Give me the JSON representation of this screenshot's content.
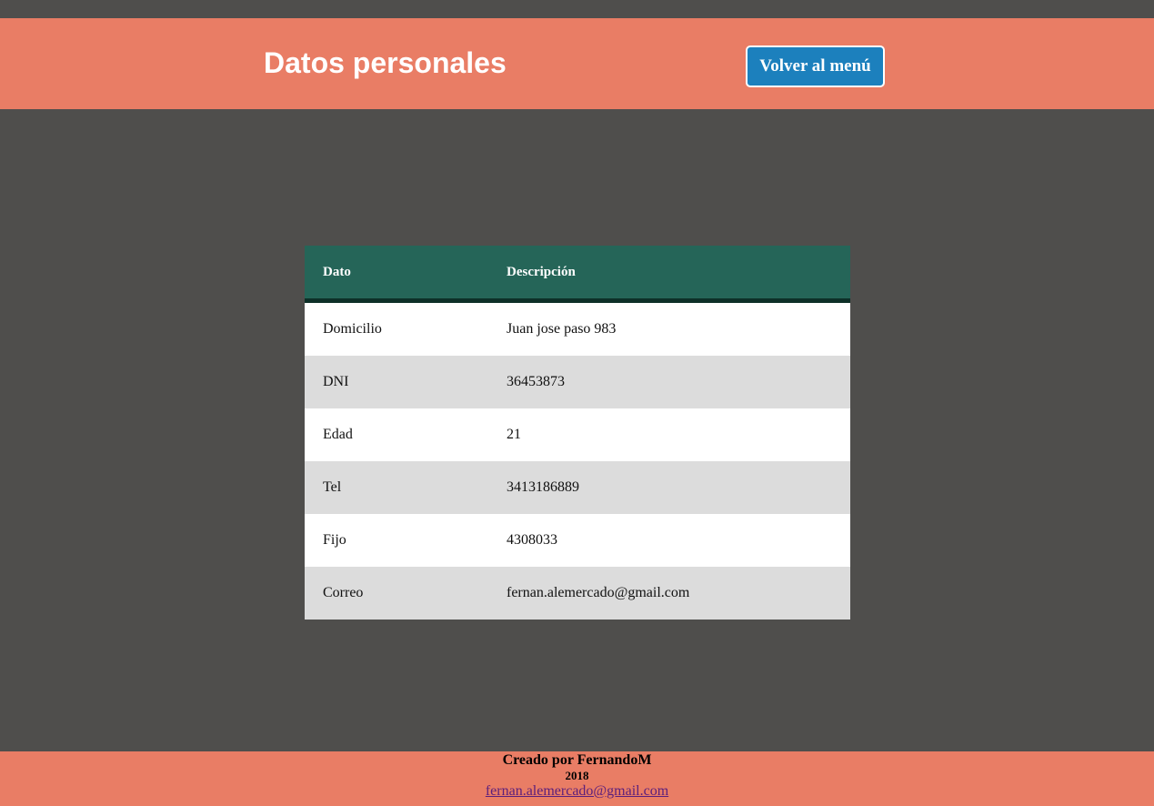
{
  "header": {
    "title": "Datos personales",
    "back_button_label": "Volver al menú"
  },
  "table": {
    "headers": {
      "dato": "Dato",
      "descripcion": "Descripción"
    },
    "rows": [
      {
        "dato": "Domicilio",
        "descripcion": "Juan jose paso 983"
      },
      {
        "dato": "DNI",
        "descripcion": "36453873"
      },
      {
        "dato": "Edad",
        "descripcion": "21"
      },
      {
        "dato": "Tel",
        "descripcion": "3413186889"
      },
      {
        "dato": "Fijo",
        "descripcion": "4308033"
      },
      {
        "dato": "Correo",
        "descripcion": "fernan.alemercado@gmail.com"
      }
    ]
  },
  "footer": {
    "credit": "Creado por FernandoM",
    "year": "2018",
    "email": "fernan.alemercado@gmail.com"
  },
  "colors": {
    "page_background": "#4f4e4c",
    "header_background": "#e97d65",
    "button_background": "#1c80bd",
    "table_header_background": "#256558",
    "row_odd": "#ffffff",
    "row_even": "#dcdcdc",
    "footer_link": "#5b1f7c"
  }
}
